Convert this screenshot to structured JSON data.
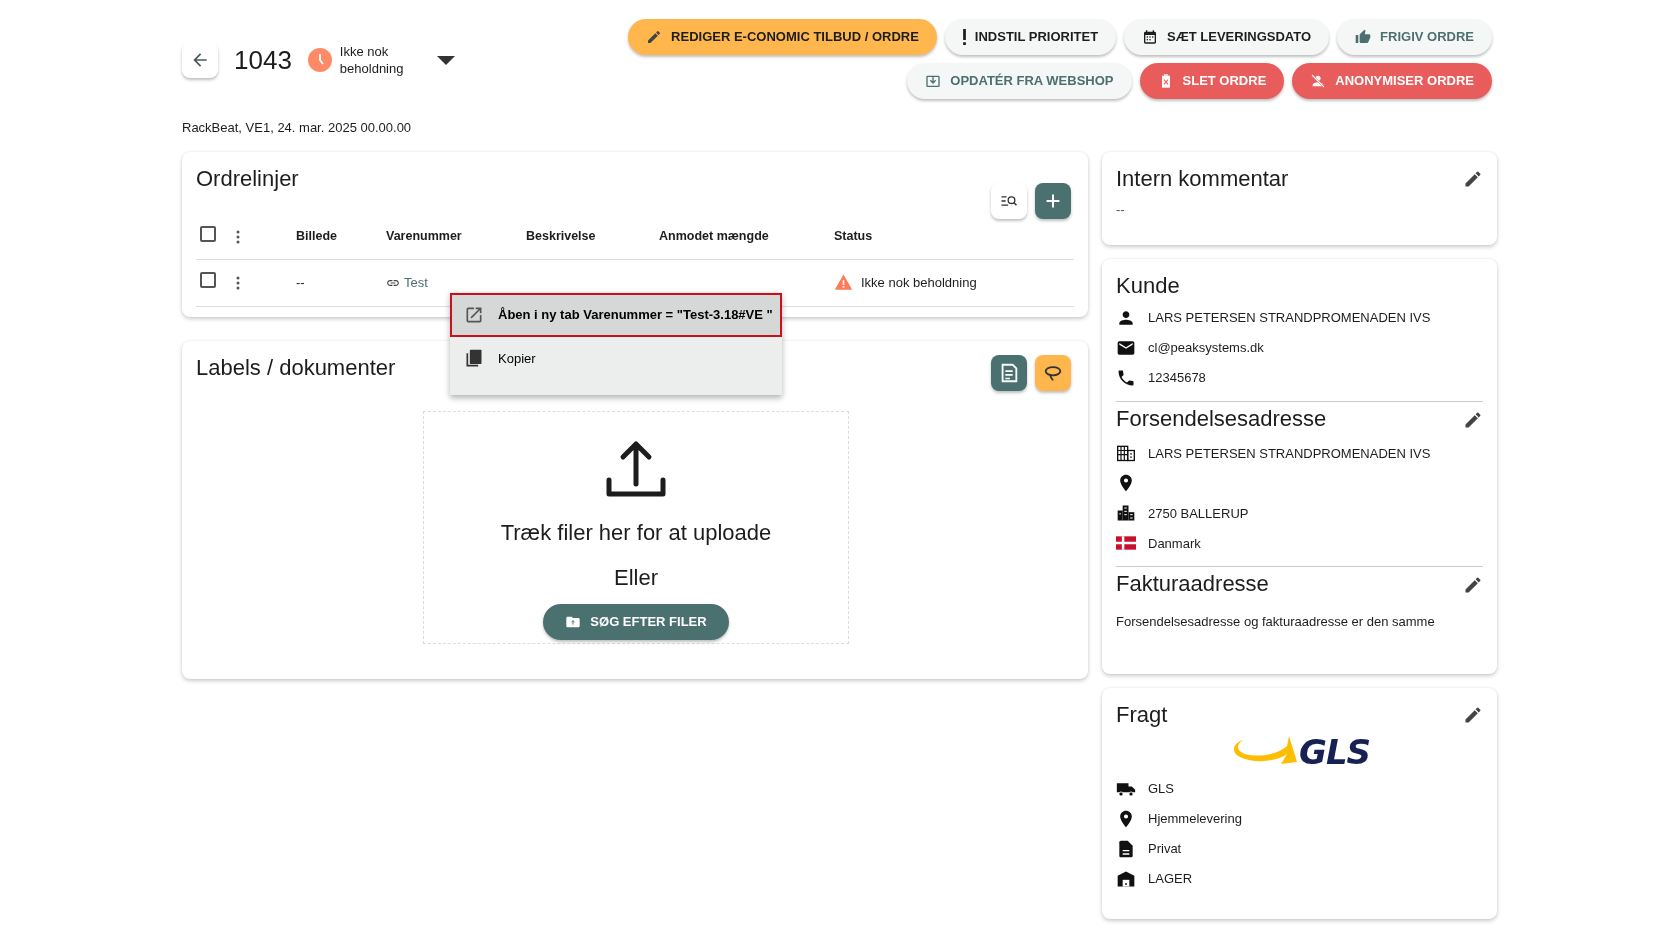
{
  "header": {
    "order_number": "1043",
    "status": "Ikke nok beholdning",
    "subtitle": "RackBeat, VE1, 24. mar. 2025 00.00.00"
  },
  "actions": [
    {
      "label": "REDIGER E-CONOMIC TILBUD / ORDRE",
      "kind": "primary"
    },
    {
      "label": "INDSTIL PRIORITET",
      "kind": "plain"
    },
    {
      "label": "SÆT LEVERINGSDATO",
      "kind": "plain"
    },
    {
      "label": "FRIGIV ORDRE",
      "kind": "muted"
    },
    {
      "label": "OPDATÉR FRA WEBSHOP",
      "kind": "muted"
    },
    {
      "label": "SLET ORDRE",
      "kind": "danger"
    },
    {
      "label": "ANONYMISER ORDRE",
      "kind": "danger"
    }
  ],
  "order_lines": {
    "title": "Ordrelinjer",
    "select_all_checked": false,
    "columns": [
      "Billede",
      "Varenummer",
      "Beskrivelse",
      "Anmodet mængde",
      "Status"
    ],
    "rows": [
      {
        "checked": false,
        "image": "--",
        "item_number": "Test",
        "status": "Ikke nok beholdning"
      }
    ]
  },
  "context_menu": {
    "items": [
      {
        "label": "Åben i ny tab Varenummer = \"Test-3.18#VE \"",
        "selected": true,
        "kind": "open"
      },
      {
        "label": "Kopier",
        "selected": false,
        "kind": "copy"
      }
    ]
  },
  "documents": {
    "title": "Labels / dokumenter",
    "prompt": "Træk filer her for at uploade",
    "or": "Eller",
    "button": "SØG EFTER FILER"
  },
  "comment": {
    "title": "Intern kommentar",
    "text": "--"
  },
  "customer": {
    "title": "Kunde",
    "lines": [
      {
        "kind": "person",
        "text": "LARS PETERSEN STRANDPROMENADEN IVS"
      },
      {
        "kind": "mail",
        "text": "cl@peaksystems.dk"
      },
      {
        "kind": "phone",
        "text": "12345678"
      }
    ]
  },
  "shipping_address": {
    "title": "Forsendelsesadresse",
    "lines": [
      {
        "kind": "company",
        "text": "LARS PETERSEN STRANDPROMENADEN IVS"
      },
      {
        "kind": "location"
      },
      {
        "kind": "city",
        "text": "2750 BALLERUP"
      },
      {
        "kind": "flag",
        "text": "Danmark"
      }
    ]
  },
  "invoice_address": {
    "title": "Fakturaadresse",
    "text": "Forsendelsesadresse og fakturaadresse er den samme"
  },
  "freight": {
    "title": "Fragt",
    "logo_text": "GLS",
    "lines": [
      {
        "kind": "truck",
        "text": "GLS"
      },
      {
        "kind": "location",
        "text": "Hjemmelevering"
      },
      {
        "kind": "document",
        "text": "Privat"
      },
      {
        "kind": "warehouse",
        "text": "LAGER"
      }
    ]
  }
}
